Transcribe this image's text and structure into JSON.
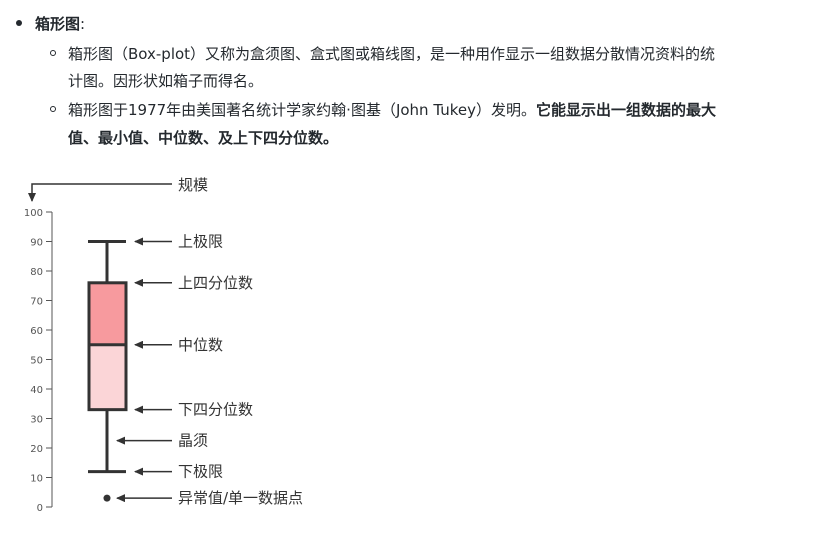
{
  "heading": {
    "title": "箱形图",
    "colon": ":"
  },
  "items": [
    {
      "line1": "箱形图（Box-plot）又称为盒须图、盒式图或箱线图，是一种用作显示一组数据分散情况资料的统",
      "line2": "计图。因形状如箱子而得名。"
    },
    {
      "line1_normal": "箱形图于1977年由美国著名统计学家约翰·图基（John Tukey）发明。",
      "line1_bold": "它能显示出一组数据的最大",
      "line2_bold": "值、最小值、中位数、及上下四分位数。"
    }
  ],
  "figure": {
    "axis_label": "规模",
    "ticks": [
      "100",
      "90",
      "80",
      "70",
      "60",
      "50",
      "40",
      "30",
      "20",
      "10",
      "0"
    ],
    "labels": {
      "upper_limit": "上极限",
      "upper_quartile": "上四分位数",
      "median": "中位数",
      "lower_quartile": "下四分位数",
      "whisker": "晶须",
      "lower_limit": "下极限",
      "outlier": "异常值/单一数据点"
    },
    "values": {
      "max": 90,
      "q3": 76,
      "median": 55,
      "q1": 33,
      "min": 12,
      "outlier": 3
    },
    "colors": {
      "upper_box": "#f79a9e",
      "lower_box": "#fbd5d7"
    }
  }
}
